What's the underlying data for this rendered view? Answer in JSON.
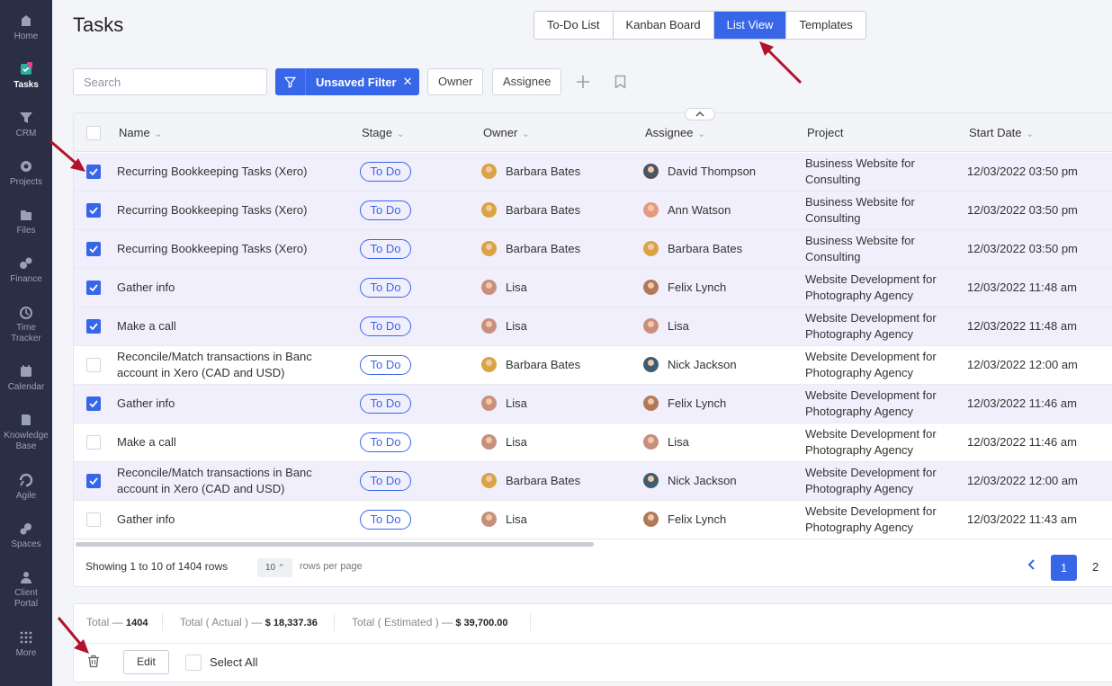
{
  "sidebar": {
    "items": [
      {
        "label": "Home",
        "icon": "home-icon"
      },
      {
        "label": "Tasks",
        "icon": "tasks-icon",
        "active": true
      },
      {
        "label": "CRM",
        "icon": "crm-icon"
      },
      {
        "label": "Projects",
        "icon": "projects-icon"
      },
      {
        "label": "Files",
        "icon": "files-icon"
      },
      {
        "label": "Finance",
        "icon": "finance-icon"
      },
      {
        "label": "Time",
        "label2": "Tracker",
        "icon": "time-tracker-icon"
      },
      {
        "label": "Calendar",
        "icon": "calendar-icon"
      },
      {
        "label": "Knowledge",
        "label2": "Base",
        "icon": "knowledge-base-icon"
      },
      {
        "label": "Agile",
        "icon": "agile-icon"
      },
      {
        "label": "Spaces",
        "icon": "spaces-icon"
      },
      {
        "label": "Client",
        "label2": "Portal",
        "icon": "client-portal-icon"
      },
      {
        "label": "More",
        "icon": "more-icon"
      }
    ]
  },
  "header": {
    "title": "Tasks",
    "tabs": [
      {
        "label": "To-Do List"
      },
      {
        "label": "Kanban Board"
      },
      {
        "label": "List View",
        "active": true
      },
      {
        "label": "Templates"
      }
    ]
  },
  "toolbar": {
    "search_placeholder": "Search",
    "filter_label": "Unsaved Filter",
    "filter_close": "✕",
    "owner_label": "Owner",
    "assignee_label": "Assignee"
  },
  "table": {
    "columns": [
      "Name",
      "Stage",
      "Owner",
      "Assignee",
      "Project",
      "Start Date"
    ],
    "rows": [
      {
        "checked": true,
        "name": [
          "Recurring Bookkeeping Tasks (Xero)"
        ],
        "stage": "To Do",
        "owner": "Barbara Bates",
        "assignee": "David Thompson",
        "project": [
          "Business Website for",
          "Consulting"
        ],
        "start": "12/03/2022 03:50 pm"
      },
      {
        "checked": true,
        "name": [
          "Recurring Bookkeeping Tasks (Xero)"
        ],
        "stage": "To Do",
        "owner": "Barbara Bates",
        "assignee": "Ann Watson",
        "project": [
          "Business Website for",
          "Consulting"
        ],
        "start": "12/03/2022 03:50 pm"
      },
      {
        "checked": true,
        "name": [
          "Recurring Bookkeeping Tasks (Xero)"
        ],
        "stage": "To Do",
        "owner": "Barbara Bates",
        "assignee": "Barbara Bates",
        "project": [
          "Business Website for",
          "Consulting"
        ],
        "start": "12/03/2022 03:50 pm"
      },
      {
        "checked": true,
        "name": [
          "Gather info"
        ],
        "stage": "To Do",
        "owner": "Lisa",
        "assignee": "Felix Lynch",
        "project": [
          "Website Development for",
          "Photography Agency"
        ],
        "start": "12/03/2022 11:48 am"
      },
      {
        "checked": true,
        "name": [
          "Make a call"
        ],
        "stage": "To Do",
        "owner": "Lisa",
        "assignee": "Lisa",
        "project": [
          "Website Development for",
          "Photography Agency"
        ],
        "start": "12/03/2022 11:48 am"
      },
      {
        "checked": false,
        "name": [
          "Reconcile/Match transactions in Banc",
          "account in Xero (CAD and USD)"
        ],
        "stage": "To Do",
        "owner": "Barbara Bates",
        "assignee": "Nick Jackson",
        "project": [
          "Website Development for",
          "Photography Agency"
        ],
        "start": "12/03/2022 12:00 am"
      },
      {
        "checked": true,
        "name": [
          "Gather info"
        ],
        "stage": "To Do",
        "owner": "Lisa",
        "assignee": "Felix Lynch",
        "project": [
          "Website Development for",
          "Photography Agency"
        ],
        "start": "12/03/2022 11:46 am"
      },
      {
        "checked": false,
        "name": [
          "Make a call"
        ],
        "stage": "To Do",
        "owner": "Lisa",
        "assignee": "Lisa",
        "project": [
          "Website Development for",
          "Photography Agency"
        ],
        "start": "12/03/2022 11:46 am"
      },
      {
        "checked": true,
        "name": [
          "Reconcile/Match transactions in Banc",
          "account in Xero (CAD and USD)"
        ],
        "stage": "To Do",
        "owner": "Barbara Bates",
        "assignee": "Nick Jackson",
        "project": [
          "Website Development for",
          "Photography Agency"
        ],
        "start": "12/03/2022 12:00 am"
      },
      {
        "checked": false,
        "name": [
          "Gather info"
        ],
        "stage": "To Do",
        "owner": "Lisa",
        "assignee": "Felix Lynch",
        "project": [
          "Website Development for",
          "Photography Agency"
        ],
        "start": "12/03/2022 11:43 am"
      }
    ]
  },
  "avatars": {
    "Barbara Bates": "#d9a441",
    "David Thompson": "#4a5560",
    "Ann Watson": "#e39a80",
    "Lisa": "#c8907c",
    "Felix Lynch": "#b07a5a",
    "Nick Jackson": "#3f5c6e"
  },
  "pagination": {
    "showing": "Showing 1 to 10 of 1404 rows",
    "rows_per_page_value": "10",
    "rows_per_page_label": "rows per page",
    "current_page": "1",
    "next_page": "2"
  },
  "totals": {
    "total_label": "Total —",
    "total_value": "1404",
    "actual_label": "Total ( Actual ) —",
    "actual_value": "$ 18,337.36",
    "estimated_label": "Total ( Estimated ) —",
    "estimated_value": "$ 39,700.00"
  },
  "bulk": {
    "edit_label": "Edit",
    "select_all_label": "Select All"
  },
  "colors": {
    "accent": "#3866e8",
    "sidebar": "#2b2f45",
    "selected_row": "#f2effc",
    "annotation_arrow": "#b3122c"
  }
}
